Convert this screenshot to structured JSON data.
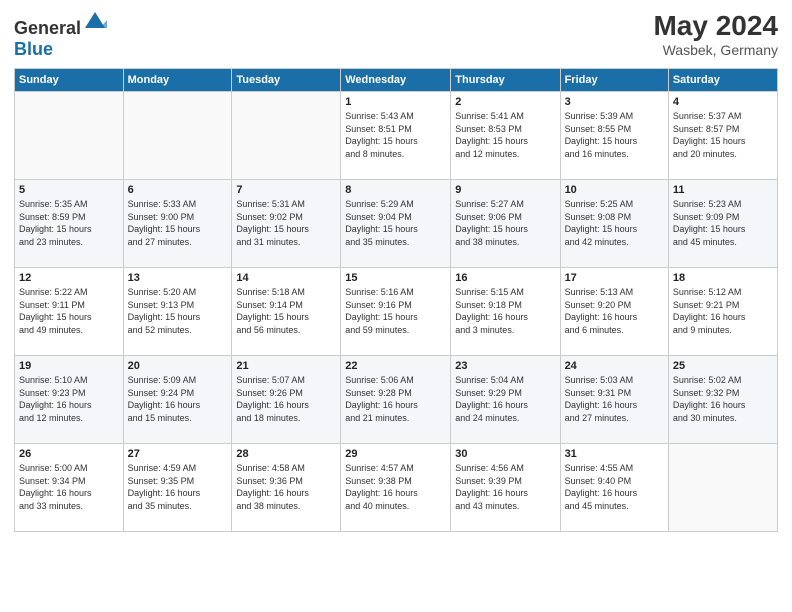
{
  "header": {
    "logo_general": "General",
    "logo_blue": "Blue",
    "month_year": "May 2024",
    "location": "Wasbek, Germany"
  },
  "days_of_week": [
    "Sunday",
    "Monday",
    "Tuesday",
    "Wednesday",
    "Thursday",
    "Friday",
    "Saturday"
  ],
  "weeks": [
    [
      {
        "day": "",
        "content": ""
      },
      {
        "day": "",
        "content": ""
      },
      {
        "day": "",
        "content": ""
      },
      {
        "day": "1",
        "content": "Sunrise: 5:43 AM\nSunset: 8:51 PM\nDaylight: 15 hours\nand 8 minutes."
      },
      {
        "day": "2",
        "content": "Sunrise: 5:41 AM\nSunset: 8:53 PM\nDaylight: 15 hours\nand 12 minutes."
      },
      {
        "day": "3",
        "content": "Sunrise: 5:39 AM\nSunset: 8:55 PM\nDaylight: 15 hours\nand 16 minutes."
      },
      {
        "day": "4",
        "content": "Sunrise: 5:37 AM\nSunset: 8:57 PM\nDaylight: 15 hours\nand 20 minutes."
      }
    ],
    [
      {
        "day": "5",
        "content": "Sunrise: 5:35 AM\nSunset: 8:59 PM\nDaylight: 15 hours\nand 23 minutes."
      },
      {
        "day": "6",
        "content": "Sunrise: 5:33 AM\nSunset: 9:00 PM\nDaylight: 15 hours\nand 27 minutes."
      },
      {
        "day": "7",
        "content": "Sunrise: 5:31 AM\nSunset: 9:02 PM\nDaylight: 15 hours\nand 31 minutes."
      },
      {
        "day": "8",
        "content": "Sunrise: 5:29 AM\nSunset: 9:04 PM\nDaylight: 15 hours\nand 35 minutes."
      },
      {
        "day": "9",
        "content": "Sunrise: 5:27 AM\nSunset: 9:06 PM\nDaylight: 15 hours\nand 38 minutes."
      },
      {
        "day": "10",
        "content": "Sunrise: 5:25 AM\nSunset: 9:08 PM\nDaylight: 15 hours\nand 42 minutes."
      },
      {
        "day": "11",
        "content": "Sunrise: 5:23 AM\nSunset: 9:09 PM\nDaylight: 15 hours\nand 45 minutes."
      }
    ],
    [
      {
        "day": "12",
        "content": "Sunrise: 5:22 AM\nSunset: 9:11 PM\nDaylight: 15 hours\nand 49 minutes."
      },
      {
        "day": "13",
        "content": "Sunrise: 5:20 AM\nSunset: 9:13 PM\nDaylight: 15 hours\nand 52 minutes."
      },
      {
        "day": "14",
        "content": "Sunrise: 5:18 AM\nSunset: 9:14 PM\nDaylight: 15 hours\nand 56 minutes."
      },
      {
        "day": "15",
        "content": "Sunrise: 5:16 AM\nSunset: 9:16 PM\nDaylight: 15 hours\nand 59 minutes."
      },
      {
        "day": "16",
        "content": "Sunrise: 5:15 AM\nSunset: 9:18 PM\nDaylight: 16 hours\nand 3 minutes."
      },
      {
        "day": "17",
        "content": "Sunrise: 5:13 AM\nSunset: 9:20 PM\nDaylight: 16 hours\nand 6 minutes."
      },
      {
        "day": "18",
        "content": "Sunrise: 5:12 AM\nSunset: 9:21 PM\nDaylight: 16 hours\nand 9 minutes."
      }
    ],
    [
      {
        "day": "19",
        "content": "Sunrise: 5:10 AM\nSunset: 9:23 PM\nDaylight: 16 hours\nand 12 minutes."
      },
      {
        "day": "20",
        "content": "Sunrise: 5:09 AM\nSunset: 9:24 PM\nDaylight: 16 hours\nand 15 minutes."
      },
      {
        "day": "21",
        "content": "Sunrise: 5:07 AM\nSunset: 9:26 PM\nDaylight: 16 hours\nand 18 minutes."
      },
      {
        "day": "22",
        "content": "Sunrise: 5:06 AM\nSunset: 9:28 PM\nDaylight: 16 hours\nand 21 minutes."
      },
      {
        "day": "23",
        "content": "Sunrise: 5:04 AM\nSunset: 9:29 PM\nDaylight: 16 hours\nand 24 minutes."
      },
      {
        "day": "24",
        "content": "Sunrise: 5:03 AM\nSunset: 9:31 PM\nDaylight: 16 hours\nand 27 minutes."
      },
      {
        "day": "25",
        "content": "Sunrise: 5:02 AM\nSunset: 9:32 PM\nDaylight: 16 hours\nand 30 minutes."
      }
    ],
    [
      {
        "day": "26",
        "content": "Sunrise: 5:00 AM\nSunset: 9:34 PM\nDaylight: 16 hours\nand 33 minutes."
      },
      {
        "day": "27",
        "content": "Sunrise: 4:59 AM\nSunset: 9:35 PM\nDaylight: 16 hours\nand 35 minutes."
      },
      {
        "day": "28",
        "content": "Sunrise: 4:58 AM\nSunset: 9:36 PM\nDaylight: 16 hours\nand 38 minutes."
      },
      {
        "day": "29",
        "content": "Sunrise: 4:57 AM\nSunset: 9:38 PM\nDaylight: 16 hours\nand 40 minutes."
      },
      {
        "day": "30",
        "content": "Sunrise: 4:56 AM\nSunset: 9:39 PM\nDaylight: 16 hours\nand 43 minutes."
      },
      {
        "day": "31",
        "content": "Sunrise: 4:55 AM\nSunset: 9:40 PM\nDaylight: 16 hours\nand 45 minutes."
      },
      {
        "day": "",
        "content": ""
      }
    ]
  ]
}
